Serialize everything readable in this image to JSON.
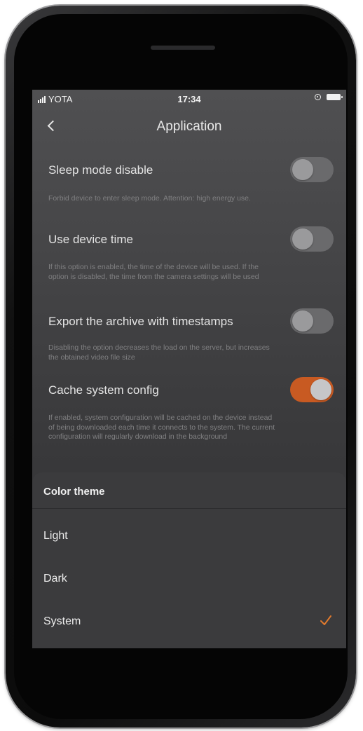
{
  "status_bar": {
    "carrier": "YOTA",
    "time": "17:34"
  },
  "nav": {
    "title": "Application"
  },
  "settings": [
    {
      "title": "Sleep mode disable",
      "description": "Forbid device to enter sleep mode. Attention: high energy use.",
      "enabled": false
    },
    {
      "title": "Use device time",
      "description": "If this option is enabled, the time of the device will be used. If the option is disabled, the time from the camera settings will be used",
      "enabled": false
    },
    {
      "title": "Export the archive with timestamps",
      "description": "Disabling the option decreases the load on the server, but increases the obtained video file size",
      "enabled": false
    },
    {
      "title": "Cache system config",
      "description": "If enabled, system configuration will be cached on the device instead of being downloaded each time it connects to the system. The current configuration will regularly download in the background",
      "enabled": true
    }
  ],
  "color_theme": {
    "title": "Color theme",
    "options": [
      "Light",
      "Dark",
      "System"
    ],
    "selected": "System"
  },
  "colors": {
    "accent": "#c85a22",
    "toggle_off": "#6a6a6c"
  },
  "icons": {
    "back": "chevron-left-icon",
    "check": "checkmark-icon"
  }
}
